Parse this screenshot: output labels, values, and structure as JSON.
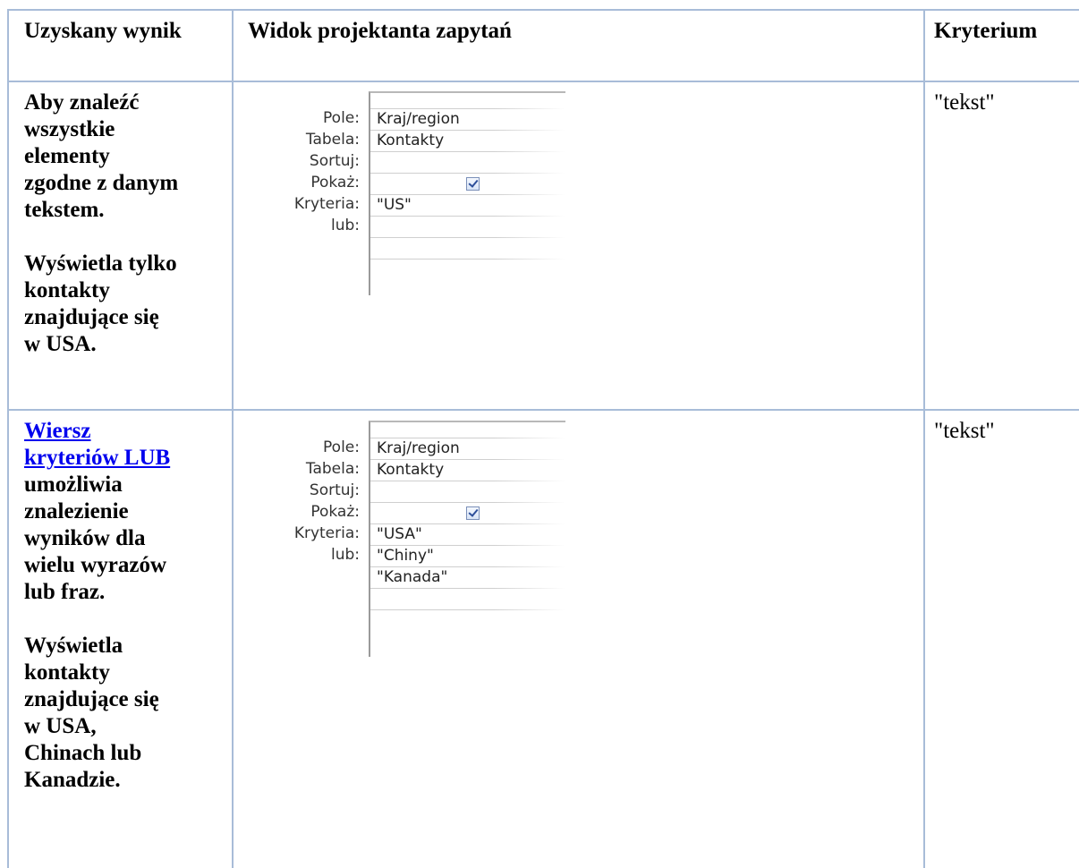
{
  "table": {
    "headers": [
      "Uzyskany wynik",
      "Widok projektanta zapytań",
      "Kryterium"
    ],
    "rows": [
      {
        "description_lines": "Aby znaleźć\nwszystkie\nelementy\nzgodne z danym\ntekstem.\n\nWyświetla tylko\nkontakty\nznajdujące się\nw USA.",
        "criterion": "\"tekst\"",
        "designer": {
          "labels": [
            "Pole:",
            "Tabela:",
            "Sortuj:",
            "Pokaż:",
            "Kryteria:",
            "lub:"
          ],
          "field": "Kraj/region",
          "table": "Kontakty",
          "sort": "",
          "show_checked": true,
          "criteria": "\"US\"",
          "or_values": [
            ""
          ]
        }
      },
      {
        "link_lines": "Wiersz\nkryteriów LUB",
        "description_lines": "umożliwia\nznalezienie\nwyników dla\nwielu wyrazów\nlub fraz.\n\nWyświetla\nkontakty\nznajdujące się\nw USA,\nChinach lub\nKanadzie.",
        "criterion": "\"tekst\"",
        "designer": {
          "labels": [
            "Pole:",
            "Tabela:",
            "Sortuj:",
            "Pokaż:",
            "Kryteria:",
            "lub:"
          ],
          "field": "Kraj/region",
          "table": "Kontakty",
          "sort": "",
          "show_checked": true,
          "criteria": "\"USA\"",
          "or_values": [
            "\"Chiny\"",
            "\"Kanada\""
          ]
        }
      }
    ]
  }
}
